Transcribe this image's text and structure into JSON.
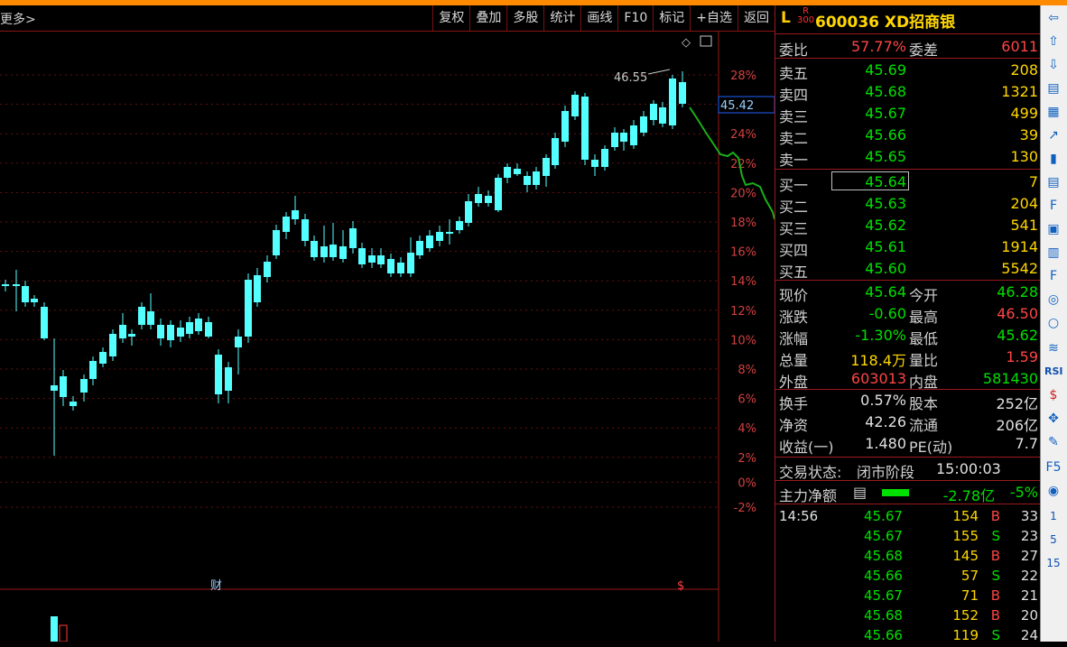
{
  "toolbar": {
    "left_label": "更多>",
    "buttons": [
      "复权",
      "叠加",
      "多股",
      "统计",
      "画线",
      "F10",
      "标记",
      "+自选",
      "返回"
    ]
  },
  "chart": {
    "price_label": "45.42",
    "peak_label": "46.55",
    "percent_ticks": [
      "28%",
      "26%",
      "24%",
      "22%",
      "20%",
      "18%",
      "16%",
      "14%",
      "12%",
      "10%",
      "8%",
      "6%",
      "4%",
      "2%",
      "0%",
      "-2%"
    ],
    "marker_cai": "财",
    "marker_s": "$"
  },
  "quote": {
    "prefix": "L",
    "board": "R",
    "board_num": "300",
    "code_name": "600036 XD招商银",
    "weibi_label": "委比",
    "weibi": "57.77%",
    "weicha_label": "委差",
    "weicha": "6011",
    "sell": [
      {
        "label": "卖五",
        "price": "45.69",
        "vol": "208"
      },
      {
        "label": "卖四",
        "price": "45.68",
        "vol": "1321"
      },
      {
        "label": "卖三",
        "price": "45.67",
        "vol": "499"
      },
      {
        "label": "卖二",
        "price": "45.66",
        "vol": "39"
      },
      {
        "label": "卖一",
        "price": "45.65",
        "vol": "130"
      }
    ],
    "buy": [
      {
        "label": "买一",
        "price": "45.64",
        "vol": "7"
      },
      {
        "label": "买二",
        "price": "45.63",
        "vol": "204"
      },
      {
        "label": "买三",
        "price": "45.62",
        "vol": "541"
      },
      {
        "label": "买四",
        "price": "45.61",
        "vol": "1914"
      },
      {
        "label": "买五",
        "price": "45.60",
        "vol": "5542"
      }
    ],
    "stats": [
      {
        "l1": "现价",
        "v1": "45.64",
        "l2": "今开",
        "v2": "46.28"
      },
      {
        "l1": "涨跌",
        "v1": "-0.60",
        "l2": "最高",
        "v2": "46.50"
      },
      {
        "l1": "涨幅",
        "v1": "-1.30%",
        "l2": "最低",
        "v2": "45.62"
      },
      {
        "l1": "总量",
        "v1": "118.4万",
        "l2": "量比",
        "v2": "1.59"
      },
      {
        "l1": "外盘",
        "v1": "603013",
        "l2": "内盘",
        "v2": "581430"
      }
    ],
    "stats2": [
      {
        "l1": "换手",
        "v1": "0.57%",
        "l2": "股本",
        "v2": "252亿"
      },
      {
        "l1": "净资",
        "v1": "42.26",
        "l2": "流通",
        "v2": "206亿"
      },
      {
        "l1": "收益(一)",
        "v1": "1.480",
        "l2": "PE(动)",
        "v2": "7.7"
      }
    ],
    "status_label": "交易状态:",
    "status_value": "闭市阶段",
    "status_time": "15:00:03",
    "main_label": "主力净额",
    "main_value": "-2.78亿",
    "main_pct": "-5%",
    "ticks": [
      {
        "time": "14:56",
        "price": "45.67",
        "vol": "154",
        "bs": "B",
        "n": "33"
      },
      {
        "time": "",
        "price": "45.67",
        "vol": "155",
        "bs": "S",
        "n": "23"
      },
      {
        "time": "",
        "price": "45.68",
        "vol": "145",
        "bs": "B",
        "n": "27"
      },
      {
        "time": "",
        "price": "45.66",
        "vol": "57",
        "bs": "S",
        "n": "22"
      },
      {
        "time": "",
        "price": "45.67",
        "vol": "71",
        "bs": "B",
        "n": "21"
      },
      {
        "time": "",
        "price": "45.68",
        "vol": "152",
        "bs": "B",
        "n": "20"
      },
      {
        "time": "",
        "price": "45.66",
        "vol": "119",
        "bs": "S",
        "n": "24"
      }
    ]
  },
  "sidebar": {
    "labels": [
      "RSI",
      "1",
      "5",
      "15"
    ]
  },
  "chart_data": {
    "type": "candlestick",
    "note_series": "daily K-line (approx.)",
    "candles": [
      [
        0,
        0,
        0,
        0
      ],
      [
        1,
        0,
        0,
        0
      ]
    ],
    "ylim_percent": [
      -3,
      29
    ]
  }
}
